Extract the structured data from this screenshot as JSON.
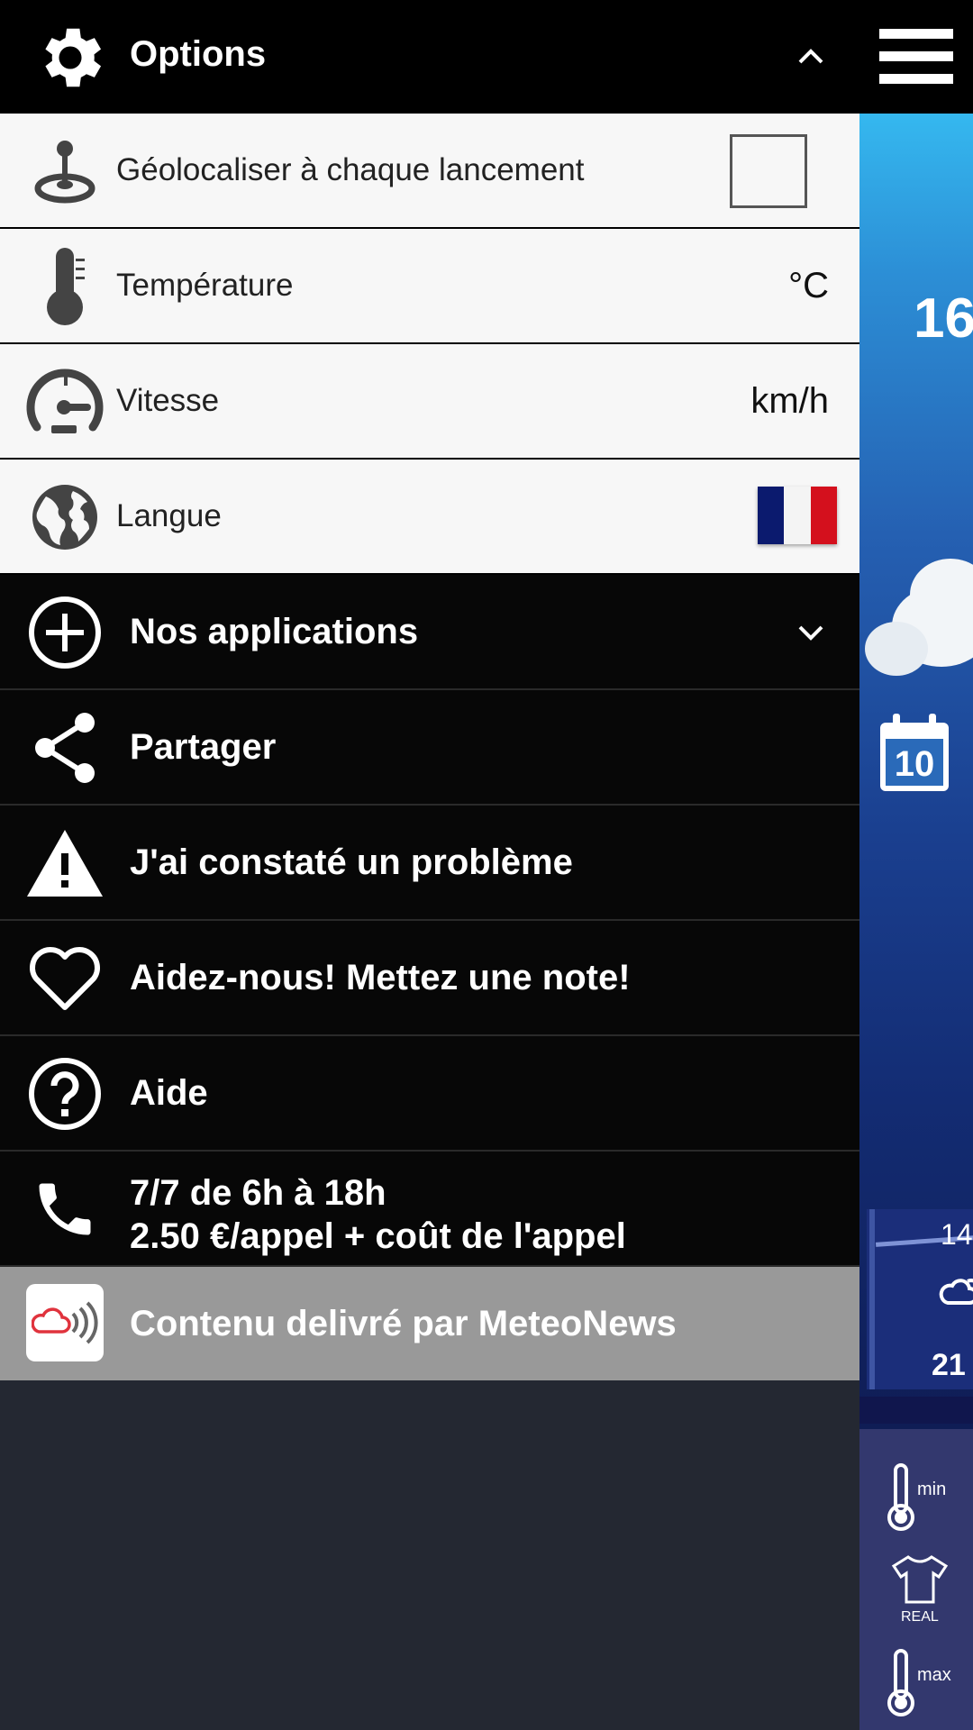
{
  "background": {
    "temperature": "16",
    "calendar_day": "10",
    "forecast_time": "14",
    "forecast_temp": "21",
    "side_icons": [
      {
        "name": "thermometer-min",
        "label": "min"
      },
      {
        "name": "tshirt-real",
        "label": "REAL"
      },
      {
        "name": "thermometer-max",
        "label": "max"
      }
    ]
  },
  "drawer": {
    "options": {
      "title": "Options",
      "icon": "gear-icon",
      "chevron": "chevron-up-icon"
    },
    "settings": [
      {
        "label": "Géolocaliser à chaque lancement",
        "icon": "joystick-icon",
        "control": "checkbox",
        "checked": false
      },
      {
        "label": "Température",
        "icon": "thermometer-icon",
        "value": "°C"
      },
      {
        "label": "Vitesse",
        "icon": "speedometer-icon",
        "value": "km/h"
      },
      {
        "label": "Langue",
        "icon": "globe-icon",
        "value_flag": "france-flag"
      }
    ],
    "menu": [
      {
        "label": "Nos applications",
        "icon": "add-circle-icon",
        "chevron": "chevron-down-icon"
      },
      {
        "label": "Partager",
        "icon": "share-icon"
      },
      {
        "label": "J'ai constaté un problème",
        "icon": "warning-icon"
      },
      {
        "label": "Aidez-nous! Mettez une note!",
        "icon": "heart-icon"
      },
      {
        "label": "Aide",
        "icon": "help-circle-icon"
      }
    ],
    "contact": {
      "line1": "7/7 de 6h à 18h",
      "line2": "2.50 €/appel + coût de l'appel",
      "icon": "phone-icon"
    },
    "footer": {
      "label": "Contenu delivré par MeteoNews",
      "icon": "meteonews-logo"
    }
  },
  "colors": {
    "drawer_dark": "#070707",
    "drawer_light": "#f7f7f7",
    "footer_gray": "#999999",
    "drawer_empty": "#242832",
    "flag_blue": "#0b1a6e",
    "flag_white": "#f4f4f4",
    "flag_red": "#d4101d"
  }
}
